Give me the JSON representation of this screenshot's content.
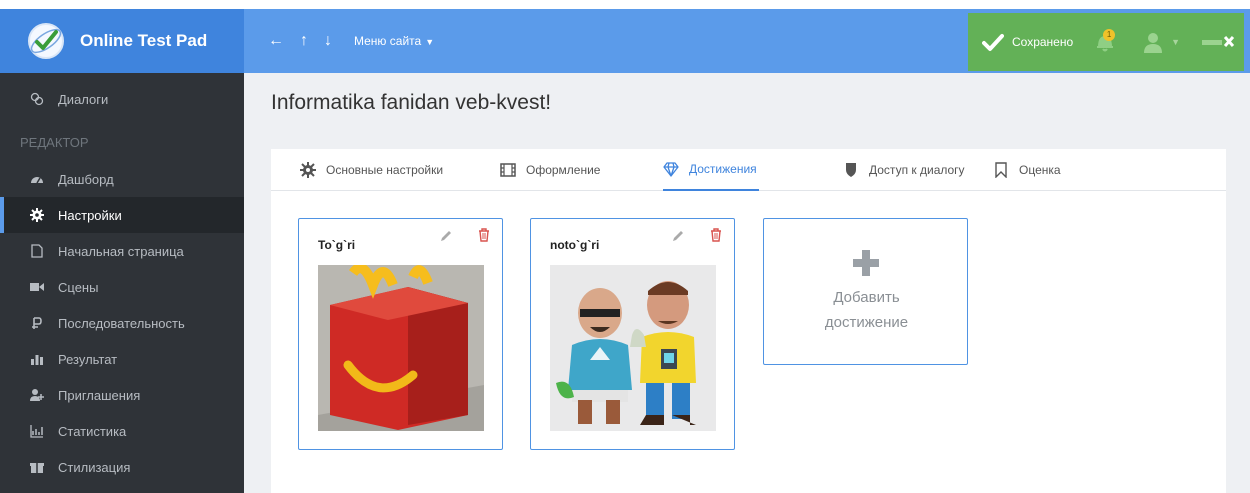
{
  "header": {
    "brand": "Online Test Pad",
    "nav": {
      "back": "←",
      "up": "↑",
      "down": "↓"
    },
    "site_menu": "Меню сайта",
    "toolbar": {
      "saved": "Сохранено",
      "notifications": "1"
    }
  },
  "sidebar": {
    "section": "РЕДАКТОР",
    "items": [
      {
        "label": "Диалоги",
        "icon": "dialogs-icon"
      },
      {
        "label": "Дашборд",
        "icon": "dashboard-icon"
      },
      {
        "label": "Настройки",
        "icon": "gear-icon",
        "active": true
      },
      {
        "label": "Начальная страница",
        "icon": "page-icon"
      },
      {
        "label": "Сцены",
        "icon": "video-icon"
      },
      {
        "label": "Последовательность",
        "icon": "sequence-icon"
      },
      {
        "label": "Результат",
        "icon": "bar-chart-icon"
      },
      {
        "label": "Приглашения",
        "icon": "invite-icon"
      },
      {
        "label": "Статистика",
        "icon": "statistics-icon"
      },
      {
        "label": "Стилизация",
        "icon": "style-icon"
      }
    ]
  },
  "main": {
    "title": "Informatika fanidan veb-kvest!",
    "tabs": [
      {
        "label": "Основные настройки",
        "icon": "gear-icon"
      },
      {
        "label": "Оформление",
        "icon": "film-icon"
      },
      {
        "label": "Достижения",
        "icon": "diamond-icon",
        "active": true
      },
      {
        "label": "Доступ к диалогу",
        "icon": "shield-icon"
      },
      {
        "label": "Оценка",
        "icon": "bookmark-icon"
      }
    ],
    "achievements": [
      {
        "name": "To`g`ri",
        "image": "red-box-photo"
      },
      {
        "name": "noto`g`ri",
        "image": "toy-figures-photo"
      }
    ],
    "add_label": "Добавить\nдостижение"
  },
  "colors": {
    "header": "#5b9bea",
    "brand": "#3f84dd",
    "toolbar": "#63b157",
    "sidebar": "#2f3338",
    "accent": "#3f84dd"
  }
}
